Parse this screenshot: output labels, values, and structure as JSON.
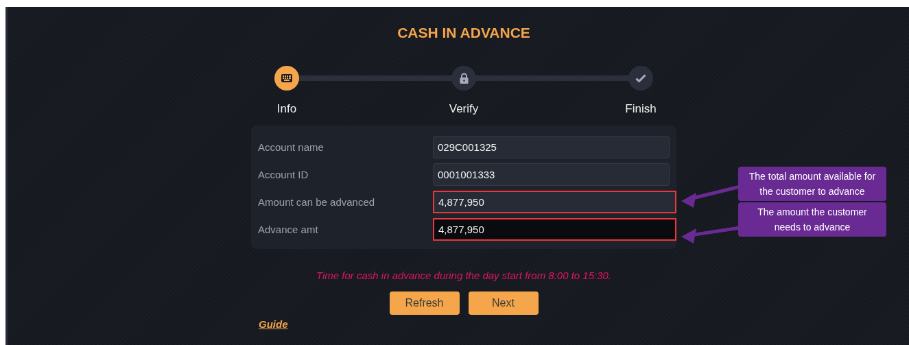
{
  "title": "CASH IN ADVANCE",
  "steps": [
    {
      "label": "Info",
      "selected": true
    },
    {
      "label": "Verify",
      "selected": false
    },
    {
      "label": "Finish",
      "selected": false
    }
  ],
  "fields": [
    {
      "label": "Account name",
      "value": "029C001325",
      "editable": false,
      "highlighted": false
    },
    {
      "label": "Account ID",
      "value": "0001001333",
      "editable": false,
      "highlighted": false
    },
    {
      "label": "Amount can be advanced",
      "value": "4,877,950",
      "editable": false,
      "highlighted": true
    },
    {
      "label": "Advance amt",
      "value": "4,877,950",
      "editable": true,
      "highlighted": true
    }
  ],
  "notice": "Time for cash in advance during the day start from 8:00 to 15:30.",
  "buttons": [
    "Refresh",
    "Next"
  ],
  "guide_link": "Guide",
  "callouts": [
    "The total amount available for the customer to advance",
    "The amount the customer needs to advance"
  ]
}
